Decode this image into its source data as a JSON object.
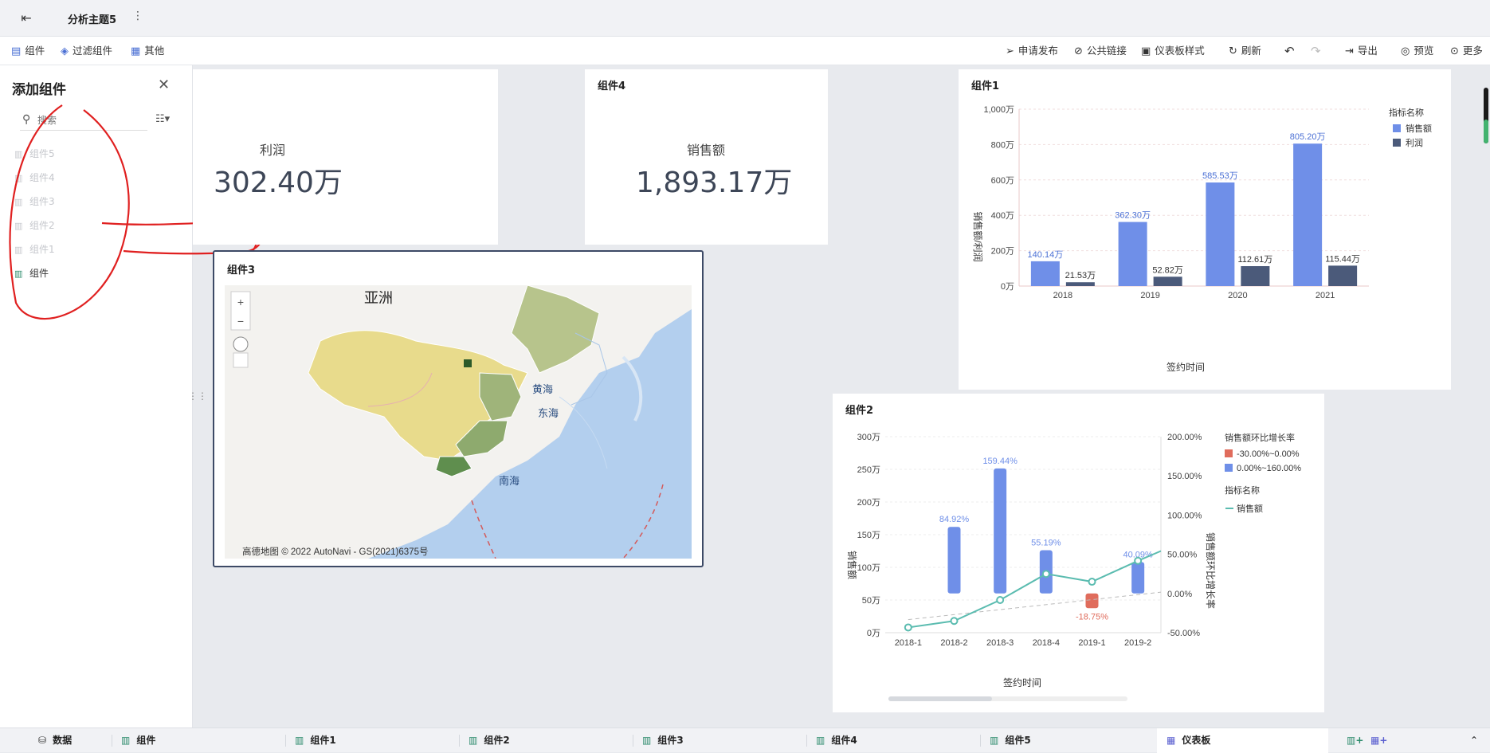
{
  "topbar": {
    "back_icon": "exit-icon",
    "title": "分析主题5",
    "more": "⋮"
  },
  "toolbar": {
    "left": [
      {
        "name": "tb-component",
        "icon": "component-icon",
        "label": "组件"
      },
      {
        "name": "tb-filter-component",
        "icon": "filter-cube-icon",
        "label": "过滤组件"
      },
      {
        "name": "tb-other",
        "icon": "doc-icon",
        "label": "其他"
      }
    ],
    "right": [
      {
        "name": "tb-apply-publish",
        "icon": "send-icon",
        "label": "申请发布"
      },
      {
        "name": "tb-public-link",
        "icon": "link-icon",
        "label": "公共链接"
      },
      {
        "name": "tb-dashboard-style",
        "icon": "style-icon",
        "label": "仪表板样式"
      },
      {
        "name": "tb-refresh",
        "icon": "refresh-icon",
        "label": "刷新"
      },
      {
        "name": "tb-undo",
        "icon": "undo-icon",
        "label": ""
      },
      {
        "name": "tb-redo",
        "icon": "redo-icon",
        "label": ""
      },
      {
        "name": "tb-export",
        "icon": "export-icon",
        "label": "导出"
      },
      {
        "name": "tb-preview",
        "icon": "preview-icon",
        "label": "预览"
      },
      {
        "name": "tb-more",
        "icon": "more-icon",
        "label": "更多"
      }
    ]
  },
  "sidebar": {
    "title": "添加组件",
    "search_placeholder": "搜索",
    "items": [
      {
        "label": "组件5",
        "active": false
      },
      {
        "label": "组件4",
        "active": false
      },
      {
        "label": "组件3",
        "active": false
      },
      {
        "label": "组件2",
        "active": false
      },
      {
        "label": "组件1",
        "active": false
      },
      {
        "label": "组件",
        "active": true
      }
    ]
  },
  "kpi_profit": {
    "label": "利润",
    "value": "302.40万"
  },
  "kpi_sales": {
    "title": "组件4",
    "label": "销售额",
    "value": "1,893.17万"
  },
  "map_card": {
    "title": "组件3",
    "labels": {
      "asia": "亚洲",
      "yellow_sea": "黄海",
      "east_sea": "东海",
      "south_sea": "南海"
    },
    "attribution": "高德地图 © 2022 AutoNavi - GS(2021)6375号",
    "zoom_in": "+",
    "zoom_out": "−"
  },
  "colors": {
    "blue": "#6f8fe8",
    "dark": "#4b5a7a",
    "teal": "#5bbcb0",
    "red": "#e06c5c"
  },
  "chart_data": [
    {
      "id": "component1",
      "title": "组件1",
      "type": "bar",
      "categories": [
        "2018",
        "2019",
        "2020",
        "2021"
      ],
      "series": [
        {
          "name": "销售额",
          "values": [
            140.14,
            362.3,
            585.53,
            805.2
          ],
          "labels": [
            "140.14万",
            "362.30万",
            "585.53万",
            "805.20万"
          ],
          "color": "#6f8fe8"
        },
        {
          "name": "利润",
          "values": [
            21.53,
            52.82,
            112.61,
            115.44
          ],
          "labels": [
            "21.53万",
            "52.82万",
            "112.61万",
            "115.44万"
          ],
          "color": "#4b5a7a"
        }
      ],
      "legend_title": "指标名称",
      "legend_position": "top-right",
      "xlabel": "签约时间",
      "ylabel": "销售额/利润",
      "ylim": [
        0,
        1000
      ],
      "yticks": [
        "0万",
        "200万",
        "400万",
        "600万",
        "800万",
        "1,000万"
      ]
    },
    {
      "id": "component2",
      "title": "组件2",
      "type": "bar",
      "categories": [
        "2018-1",
        "2018-2",
        "2018-3",
        "2018-4",
        "2019-1",
        "2019-2"
      ],
      "bar_series": {
        "name": "销售额环比增长率",
        "values": [
          null,
          84.92,
          159.44,
          55.19,
          -18.75,
          40.09
        ],
        "labels": [
          "",
          "84.92%",
          "159.44%",
          "55.19%",
          "-18.75%",
          "40.09%"
        ]
      },
      "line_series": {
        "name": "销售额",
        "values": [
          8,
          18,
          50,
          90,
          78,
          110
        ]
      },
      "legend_title_1": "销售额环比增长率",
      "legend_ranges": [
        {
          "label": "-30.00%~0.00%",
          "color": "#e06c5c"
        },
        {
          "label": "0.00%~160.00%",
          "color": "#6f8fe8"
        }
      ],
      "legend_title_2": "指标名称",
      "legend_line": "销售额",
      "xlabel": "签约时间",
      "ylabel_left": "销售额",
      "ylabel_right": "销售额环比增长率",
      "yticks_left": [
        "0万",
        "50万",
        "100万",
        "150万",
        "200万",
        "250万",
        "300万"
      ],
      "yticks_right": [
        "-50.00%",
        "0.00%",
        "50.00%",
        "100.00%",
        "150.00%",
        "200.00%"
      ],
      "ylim_left": [
        0,
        300
      ],
      "ylim_right": [
        -50,
        200
      ]
    }
  ],
  "bottom_tabs": [
    {
      "label": "数据",
      "icon": "database-icon",
      "selected": false
    },
    {
      "label": "组件",
      "icon": "chart-icon",
      "selected": false
    },
    {
      "label": "组件1",
      "icon": "chart-icon",
      "selected": false
    },
    {
      "label": "组件2",
      "icon": "chart-icon",
      "selected": false
    },
    {
      "label": "组件3",
      "icon": "chart-icon",
      "selected": false
    },
    {
      "label": "组件4",
      "icon": "chart-icon",
      "selected": false
    },
    {
      "label": "组件5",
      "icon": "chart-icon",
      "selected": false
    },
    {
      "label": "仪表板",
      "icon": "dashboard-icon",
      "selected": true
    }
  ]
}
